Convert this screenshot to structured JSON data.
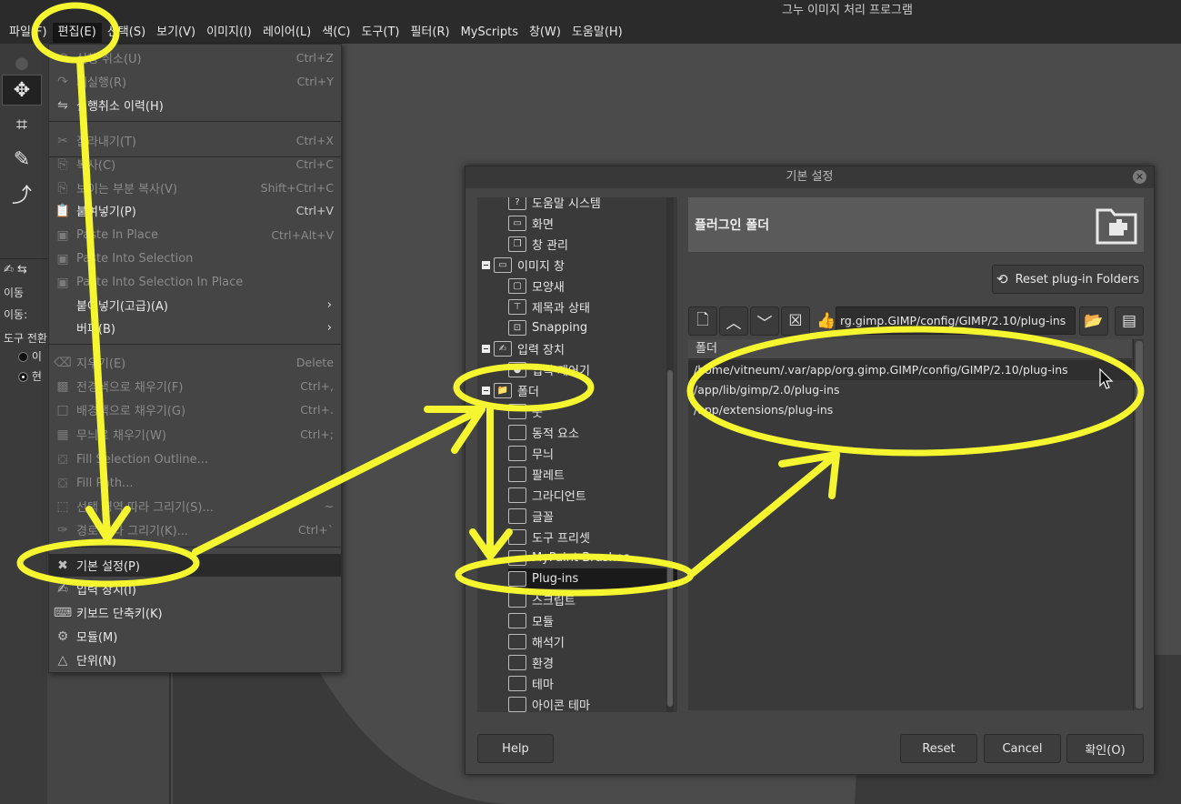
{
  "window": {
    "title": "그누 이미지 처리 프로그램"
  },
  "menubar": {
    "items": [
      {
        "label": "파일(F)"
      },
      {
        "label": "편집(E)",
        "active": true
      },
      {
        "label": "선택(S)"
      },
      {
        "label": "보기(V)"
      },
      {
        "label": "이미지(I)"
      },
      {
        "label": "레이어(L)"
      },
      {
        "label": "색(C)"
      },
      {
        "label": "도구(T)"
      },
      {
        "label": "필터(R)"
      },
      {
        "label": "MyScripts"
      },
      {
        "label": "창(W)"
      },
      {
        "label": "도움말(H)"
      }
    ]
  },
  "toolbox": {
    "tools": [
      "move-tool-icon",
      "crop-tool-icon",
      "paintbrush-tool-icon",
      "warp-tool-icon"
    ],
    "options": {
      "tool_name": "이동",
      "move_label": "이동:",
      "toggle_label": "도구 전환",
      "radio_1": "이",
      "radio_2": "현"
    }
  },
  "edit_menu": {
    "items": [
      {
        "label": "실행 취소(U)",
        "shortcut": "Ctrl+Z",
        "disabled": true,
        "icon": "undo-icon"
      },
      {
        "label": "재실행(R)",
        "shortcut": "Ctrl+Y",
        "disabled": true,
        "icon": "redo-icon"
      },
      {
        "label": "실행취소 이력(H)",
        "shortcut": "",
        "disabled": false,
        "icon": "undo-history-icon"
      },
      {
        "label": "잘라내기(T)",
        "shortcut": "Ctrl+X",
        "disabled": true,
        "icon": "cut-icon"
      },
      {
        "label": "복사(C)",
        "shortcut": "Ctrl+C",
        "disabled": true,
        "icon": "copy-icon"
      },
      {
        "label": "보이는 부분 복사(V)",
        "shortcut": "Shift+Ctrl+C",
        "disabled": true,
        "icon": "copy-visible-icon"
      },
      {
        "label": "붙여넣기(P)",
        "shortcut": "Ctrl+V",
        "disabled": false,
        "icon": "paste-icon"
      },
      {
        "label": "Paste In Place",
        "shortcut": "Ctrl+Alt+V",
        "disabled": true,
        "icon": "paste-in-place-icon"
      },
      {
        "label": "Paste Into Selection",
        "shortcut": "",
        "disabled": true,
        "icon": "paste-into-selection-icon"
      },
      {
        "label": "Paste Into Selection In Place",
        "shortcut": "",
        "disabled": true,
        "icon": "paste-into-selection-in-place-icon"
      },
      {
        "label": "붙여넣기(고급)(A)",
        "shortcut": "",
        "disabled": false,
        "submenu": true,
        "icon": ""
      },
      {
        "label": "버퍼(B)",
        "shortcut": "",
        "disabled": false,
        "submenu": true,
        "icon": ""
      },
      {
        "label": "지우기(E)",
        "shortcut": "Delete",
        "disabled": true,
        "icon": "clear-icon"
      },
      {
        "label": "전경색으로 채우기(F)",
        "shortcut": "Ctrl+,",
        "disabled": true,
        "icon": "fill-fg-icon"
      },
      {
        "label": "배경색으로 채우기(G)",
        "shortcut": "Ctrl+.",
        "disabled": true,
        "icon": "fill-bg-icon"
      },
      {
        "label": "무늬로 채우기(W)",
        "shortcut": "Ctrl+;",
        "disabled": true,
        "icon": "fill-pattern-icon"
      },
      {
        "label": "Fill Selection Outline...",
        "shortcut": "",
        "disabled": true,
        "icon": "fill-selection-outline-icon"
      },
      {
        "label": "Fill Path...",
        "shortcut": "",
        "disabled": true,
        "icon": "fill-path-icon"
      },
      {
        "label": "선택 영역 따라 그리기(S)...",
        "shortcut": "~",
        "disabled": true,
        "icon": "stroke-selection-icon"
      },
      {
        "label": "경로 따라 그리기(K)...",
        "shortcut": "Ctrl+`",
        "disabled": true,
        "icon": "stroke-path-icon"
      },
      {
        "label": "기본 설정(P)",
        "shortcut": "",
        "disabled": false,
        "icon": "preferences-icon"
      },
      {
        "label": "입력 장치(I)",
        "shortcut": "",
        "disabled": false,
        "icon": "input-devices-icon"
      },
      {
        "label": "키보드 단축키(K)",
        "shortcut": "",
        "disabled": false,
        "icon": "keyboard-shortcuts-icon"
      },
      {
        "label": "모듈(M)",
        "shortcut": "",
        "disabled": false,
        "icon": "modules-icon"
      },
      {
        "label": "단위(N)",
        "shortcut": "",
        "disabled": false,
        "icon": "units-icon"
      }
    ]
  },
  "prefs": {
    "title": "기본 설정",
    "tree": [
      {
        "label": "도움말 시스템",
        "icon": "help-system-icon",
        "level": 1
      },
      {
        "label": "화면",
        "icon": "display-icon",
        "level": 1
      },
      {
        "label": "창 관리",
        "icon": "window-management-icon",
        "level": 1
      },
      {
        "label": "이미지 창",
        "icon": "image-window-icon",
        "level": 0,
        "expanded": true
      },
      {
        "label": "모양새",
        "icon": "appearance-icon",
        "level": 1
      },
      {
        "label": "제목과 상태",
        "icon": "title-status-icon",
        "level": 1
      },
      {
        "label": "Snapping",
        "icon": "snapping-icon",
        "level": 1
      },
      {
        "label": "입력 장치",
        "icon": "input-device-icon",
        "level": 0,
        "expanded": true
      },
      {
        "label": "입력 제어기",
        "icon": "input-controllers-icon",
        "level": 1
      },
      {
        "label": "폴더",
        "icon": "folders-icon",
        "level": 0,
        "expanded": true
      },
      {
        "label": "붓",
        "icon": "brushes-folder-icon",
        "level": 1
      },
      {
        "label": "동적 요소",
        "icon": "dynamics-folder-icon",
        "level": 1
      },
      {
        "label": "무늬",
        "icon": "patterns-folder-icon",
        "level": 1
      },
      {
        "label": "팔레트",
        "icon": "palettes-folder-icon",
        "level": 1
      },
      {
        "label": "그라디언트",
        "icon": "gradients-folder-icon",
        "level": 1
      },
      {
        "label": "글꼴",
        "icon": "fonts-folder-icon",
        "level": 1
      },
      {
        "label": "도구 프리셋",
        "icon": "tool-presets-folder-icon",
        "level": 1
      },
      {
        "label": "MyPaint Brushes",
        "icon": "mypaint-brushes-folder-icon",
        "level": 1
      },
      {
        "label": "Plug-ins",
        "icon": "plugins-folder-icon",
        "level": 1,
        "selected": true
      },
      {
        "label": "스크립트",
        "icon": "scripts-folder-icon",
        "level": 1
      },
      {
        "label": "모듈",
        "icon": "modules-folder-icon",
        "level": 1
      },
      {
        "label": "해석기",
        "icon": "interpreters-folder-icon",
        "level": 1
      },
      {
        "label": "환경",
        "icon": "environment-folder-icon",
        "level": 1
      },
      {
        "label": "테마",
        "icon": "themes-folder-icon",
        "level": 1
      },
      {
        "label": "아이콘 테마",
        "icon": "icon-themes-folder-icon",
        "level": 1
      }
    ],
    "pane_title": "플러그인 폴더",
    "reset_folders_label": "Reset plug-in Folders",
    "path_entry_value": "rg.gimp.GIMP/config/GIMP/2.10/plug-ins",
    "list_header": "폴더",
    "folders": [
      "/home/vitneum/.var/app/org.gimp.GIMP/config/GIMP/2.10/plug-ins",
      "/app/lib/gimp/2.0/plug-ins",
      "/app/extensions/plug-ins"
    ],
    "buttons": {
      "help": "Help",
      "reset": "Reset",
      "cancel": "Cancel",
      "ok": "확인(O)"
    }
  },
  "colors": {
    "annotation": "#f5f530",
    "menubar_bg": "#2b2b2b",
    "panel_bg": "#454545"
  }
}
